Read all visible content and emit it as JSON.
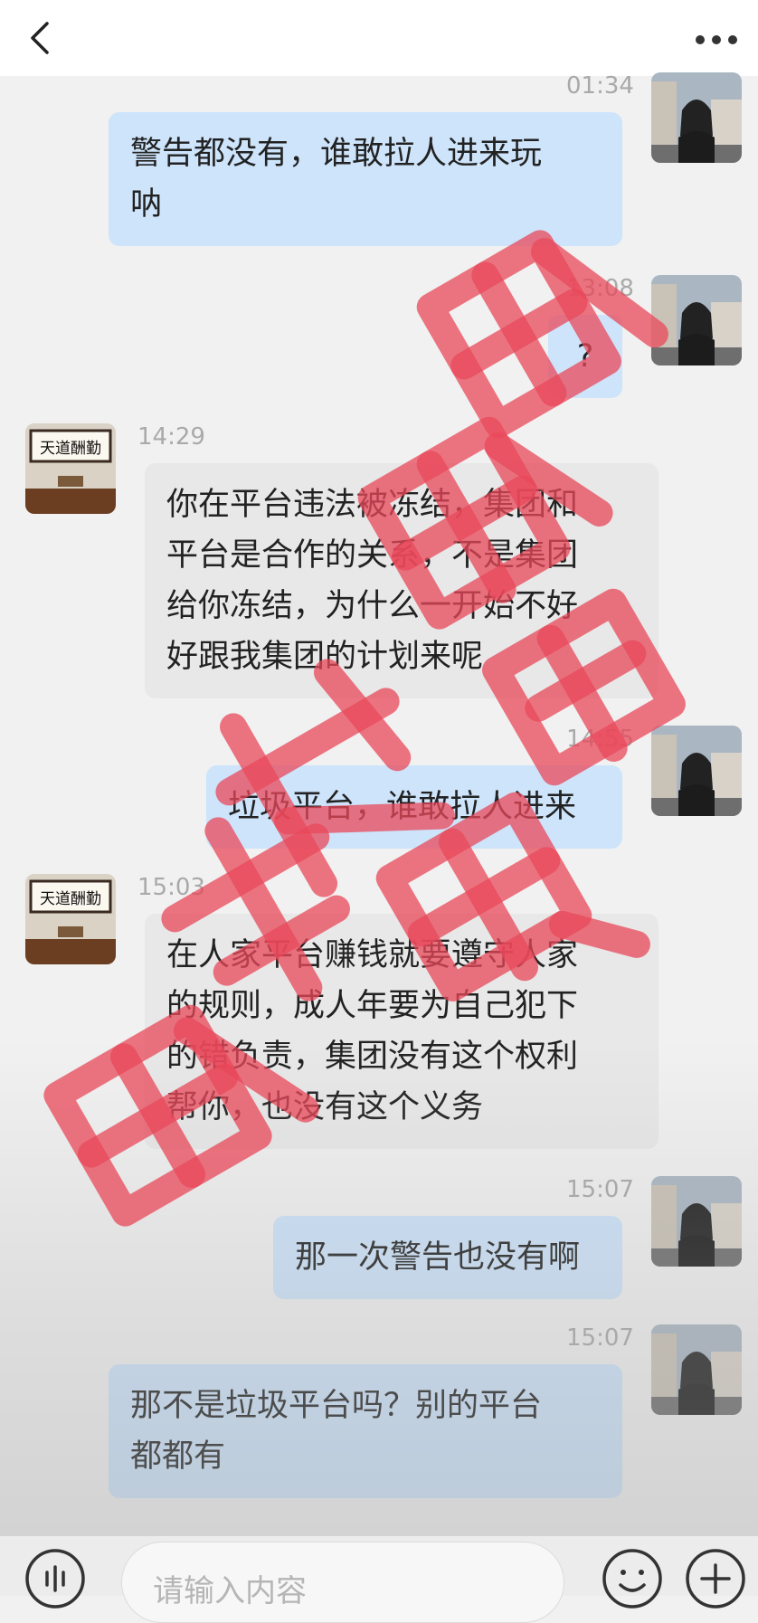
{
  "header": {
    "back_icon": "chevron-left-icon",
    "more_icon": "more-dots-icon"
  },
  "messages": [
    {
      "side": "me",
      "time": "01:34",
      "text": "警告都没有，谁敢拉人进来玩\n呐"
    },
    {
      "side": "me",
      "time": "13:08",
      "text": "?"
    },
    {
      "side": "other",
      "time": "14:29",
      "text": "你在平台违法被冻结，集团和\n平台是合作的关系，不是集团\n给你冻结，为什么一开始不好\n好跟我集团的计划来呢"
    },
    {
      "side": "me",
      "time": "14:55",
      "text": "垃圾平台，谁敢拉人进来"
    },
    {
      "side": "other",
      "time": "15:03",
      "text": "在人家平台赚钱就要遵守人家\n的规则，成人年要为自己犯下\n的错负责，集团没有这个权利\n帮你，也没有这个义务"
    },
    {
      "side": "me",
      "time": "15:07",
      "text": "那一次警告也没有啊"
    },
    {
      "side": "me",
      "time": "15:07",
      "text": "那不是垃圾平台吗？别的平台\n都都有"
    }
  ],
  "other_avatar_text": {
    "top": "天道酬勤"
  },
  "watermark": {
    "text": "账号已冻结",
    "color": "#e8485a"
  },
  "input": {
    "placeholder": "请输入内容"
  },
  "bottom": {
    "voice_icon": "voice-icon",
    "emoji_icon": "emoji-icon",
    "plus_icon": "plus-icon"
  },
  "colors": {
    "me_bubble": "#cde4fb",
    "other_bubble": "#e8e8e8",
    "timestamp": "#a9a9a9"
  }
}
